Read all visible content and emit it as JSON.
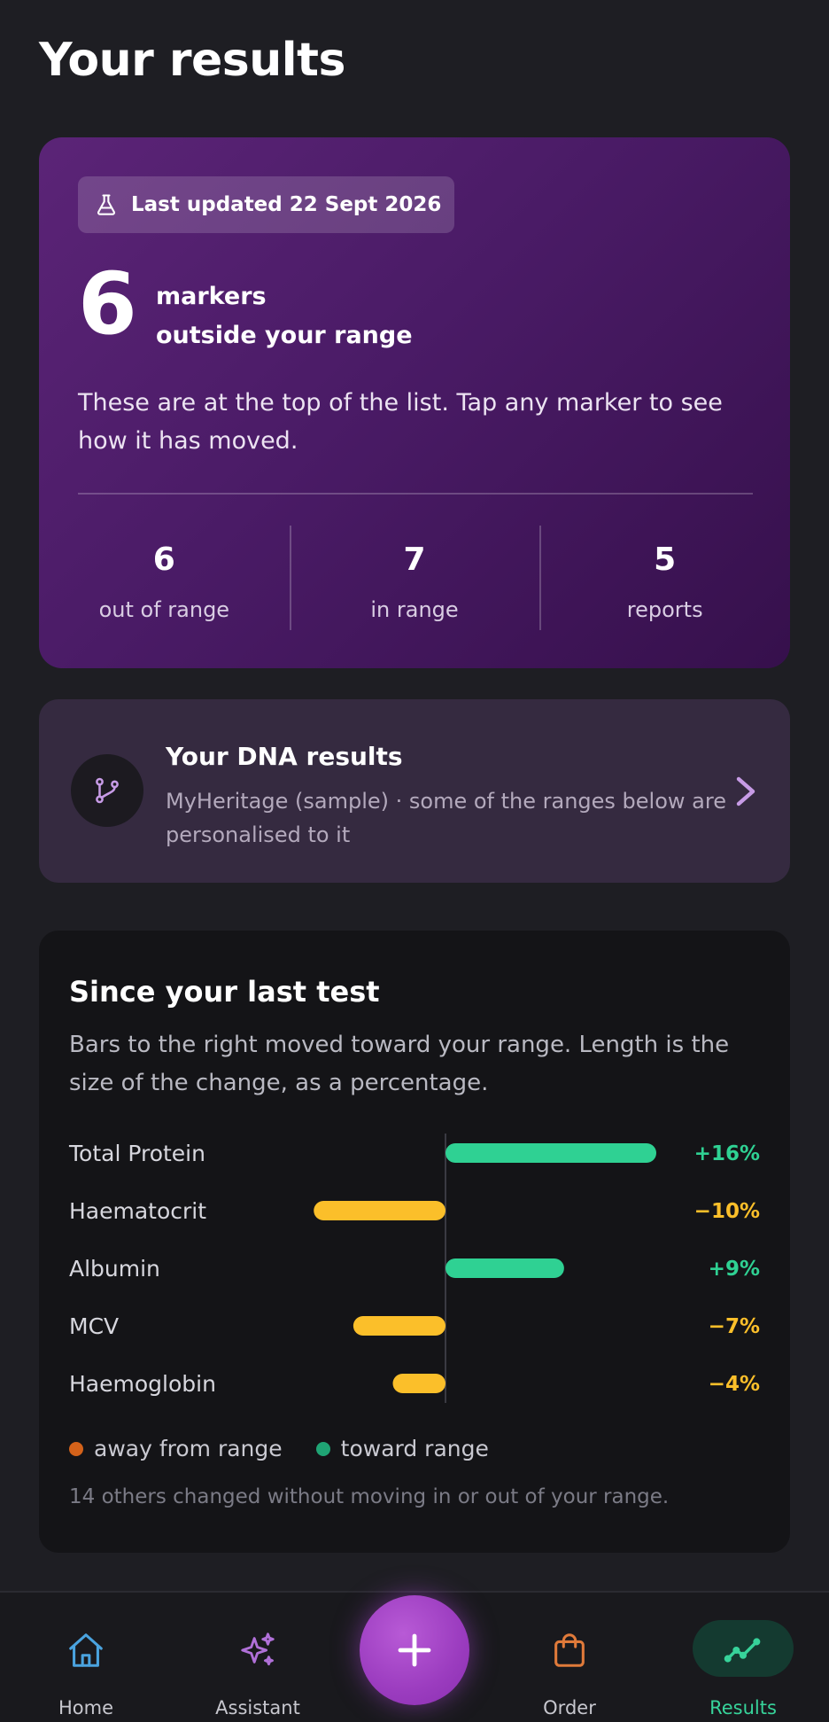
{
  "page": {
    "title": "Your results"
  },
  "summary": {
    "updated_label": "Last updated 22 Sept 2026",
    "count": "6",
    "count_line1": "markers",
    "count_line2": "outside your range",
    "description": "These are at the top of the list. Tap any marker to see how it has moved.",
    "stats": [
      {
        "value": "6",
        "label": "out of range"
      },
      {
        "value": "7",
        "label": "in range"
      },
      {
        "value": "5",
        "label": "reports"
      }
    ]
  },
  "dna": {
    "title": "Your DNA results",
    "subtitle": "MyHeritage (sample) · some of the ranges below are personalised to it"
  },
  "changes": {
    "title": "Since your last test",
    "description": "Bars to the right moved toward your range. Length is the size of the change, as a percentage.",
    "legend_away": "away from range",
    "legend_toward": "toward range",
    "footnote": "14 others changed without moving in or out of your range."
  },
  "colors": {
    "toward": "#2fd193",
    "away": "#fbbf2a",
    "legend_away_dot": "#d4621a",
    "legend_toward_dot": "#1fa474",
    "accent": "#9b3cbf"
  },
  "chart_data": {
    "type": "bar",
    "orientation": "horizontal-diverging",
    "categories": [
      "Total Protein",
      "Haematocrit",
      "Albumin",
      "MCV",
      "Haemoglobin"
    ],
    "values": [
      16,
      -10,
      9,
      -7,
      -4
    ],
    "value_labels": [
      "+16%",
      "−10%",
      "+9%",
      "−7%",
      "−4%"
    ],
    "unit": "%",
    "xlim": [
      -16,
      16
    ]
  },
  "nav": {
    "items": [
      {
        "label": "Home",
        "icon": "home-icon"
      },
      {
        "label": "Assistant",
        "icon": "sparkles-icon"
      },
      {
        "label": "Order",
        "icon": "shopping-bag-icon"
      },
      {
        "label": "Results",
        "icon": "trend-line-icon"
      }
    ],
    "fab_icon": "plus-icon"
  }
}
